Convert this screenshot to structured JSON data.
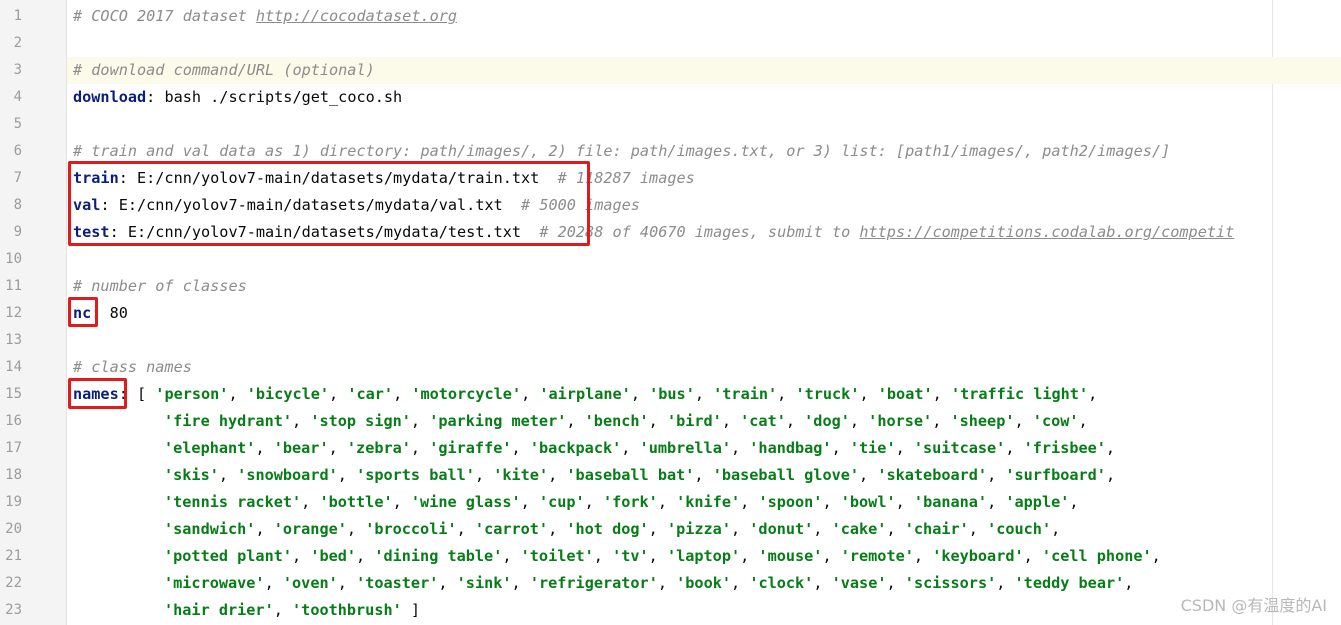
{
  "line_numbers": [
    "1",
    "2",
    "3",
    "4",
    "5",
    "6",
    "7",
    "8",
    "9",
    "10",
    "11",
    "12",
    "13",
    "14",
    "15",
    "16",
    "17",
    "18",
    "19",
    "20",
    "21",
    "22",
    "23"
  ],
  "code": {
    "l1_comment": "# COCO 2017 dataset ",
    "l1_url": "http://cocodataset.org",
    "l3_comment": "# download command/URL (optional)",
    "l4_key": "download",
    "l4_value": ": bash ./scripts/get_coco.sh",
    "l6_comment": "# train and val data as 1) directory: path/images/, 2) file: path/images.txt, or 3) list: [path1/images/, path2/images/]",
    "l7_key": "train",
    "l7_value": ": E:/cnn/yolov7-main/datasets/mydata/train.txt  ",
    "l7_comment": "# 118287 images",
    "l8_key": "val",
    "l8_value": ": E:/cnn/yolov7-main/datasets/mydata/val.txt  ",
    "l8_comment": "# 5000 images",
    "l9_key": "test",
    "l9_value": ": E:/cnn/yolov7-main/datasets/mydata/test.txt  ",
    "l9_comment": "# 20288 of 40670 images, submit to ",
    "l9_url": "https://competitions.codalab.org/competit",
    "l11_comment": "# number of classes",
    "l12_key": "nc",
    "l12_value": ": 80",
    "l14_comment": "# class names",
    "l15_key": "names",
    "l15_open": ": [ ",
    "l23_close": " ]",
    "sep": ", "
  },
  "class_names": [
    [
      "'person'",
      "'bicycle'",
      "'car'",
      "'motorcycle'",
      "'airplane'",
      "'bus'",
      "'train'",
      "'truck'",
      "'boat'",
      "'traffic light'"
    ],
    [
      "'fire hydrant'",
      "'stop sign'",
      "'parking meter'",
      "'bench'",
      "'bird'",
      "'cat'",
      "'dog'",
      "'horse'",
      "'sheep'",
      "'cow'"
    ],
    [
      "'elephant'",
      "'bear'",
      "'zebra'",
      "'giraffe'",
      "'backpack'",
      "'umbrella'",
      "'handbag'",
      "'tie'",
      "'suitcase'",
      "'frisbee'"
    ],
    [
      "'skis'",
      "'snowboard'",
      "'sports ball'",
      "'kite'",
      "'baseball bat'",
      "'baseball glove'",
      "'skateboard'",
      "'surfboard'"
    ],
    [
      "'tennis racket'",
      "'bottle'",
      "'wine glass'",
      "'cup'",
      "'fork'",
      "'knife'",
      "'spoon'",
      "'bowl'",
      "'banana'",
      "'apple'"
    ],
    [
      "'sandwich'",
      "'orange'",
      "'broccoli'",
      "'carrot'",
      "'hot dog'",
      "'pizza'",
      "'donut'",
      "'cake'",
      "'chair'",
      "'couch'"
    ],
    [
      "'potted plant'",
      "'bed'",
      "'dining table'",
      "'toilet'",
      "'tv'",
      "'laptop'",
      "'mouse'",
      "'remote'",
      "'keyboard'",
      "'cell phone'"
    ],
    [
      "'microwave'",
      "'oven'",
      "'toaster'",
      "'sink'",
      "'refrigerator'",
      "'book'",
      "'clock'",
      "'vase'",
      "'scissors'",
      "'teddy bear'"
    ],
    [
      "'hair drier'",
      "'toothbrush'"
    ]
  ],
  "watermark": "CSDN @有温度的AI",
  "colors": {
    "highlight_box": "#e01b1b",
    "key": "#0b1f78",
    "string": "#067d17",
    "comment": "#8c8c8c",
    "current_line": "#fcfae8"
  }
}
